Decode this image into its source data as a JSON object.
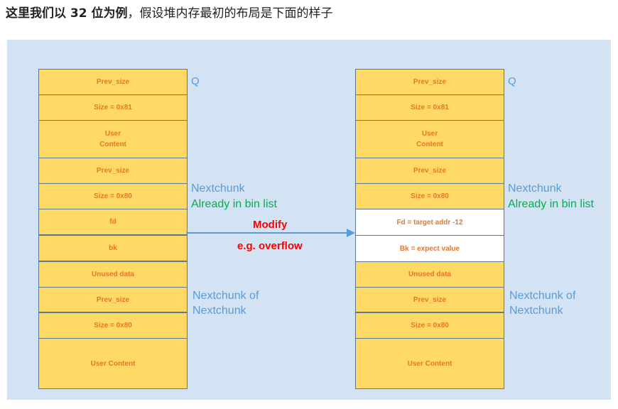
{
  "heading": {
    "bold_text": "这里我们以 32 位为例",
    "rest_text": "，假设堆内存最初的布局是下面的样子"
  },
  "left_chunk": {
    "cells": [
      "Prev_size",
      "Size = 0x81",
      "User\nContent",
      "Prev_size",
      "Size = 0x80",
      "fd",
      "bk",
      "Unused data",
      "Prev_size",
      "Size = 0x80",
      "User Content"
    ]
  },
  "right_chunk": {
    "cells": [
      "Prev_size",
      "Size = 0x81",
      "User\nContent",
      "Prev_size",
      "Size = 0x80",
      "Fd = target addr -12",
      "Bk = expect value",
      "Unused data",
      "Prev_size",
      "Size = 0x80",
      "User Content"
    ]
  },
  "labels": {
    "q": "Q",
    "nextchunk": "Nextchunk",
    "already_in_bin_list": "Already in bin list",
    "nextchunk_of_1": "Nextchunk of",
    "nextchunk_of_2": "Nextchunk"
  },
  "arrow": {
    "label_top": "Modify",
    "label_bottom": "e.g. overflow",
    "color": "#5b9bd5"
  },
  "colors": {
    "panel": "#d3e3f3",
    "cell_fill": "#ffd966",
    "cell_text": "#e8752b",
    "label_blue": "#5b9bd5",
    "label_green": "#00b050",
    "label_red": "#ff0000"
  }
}
